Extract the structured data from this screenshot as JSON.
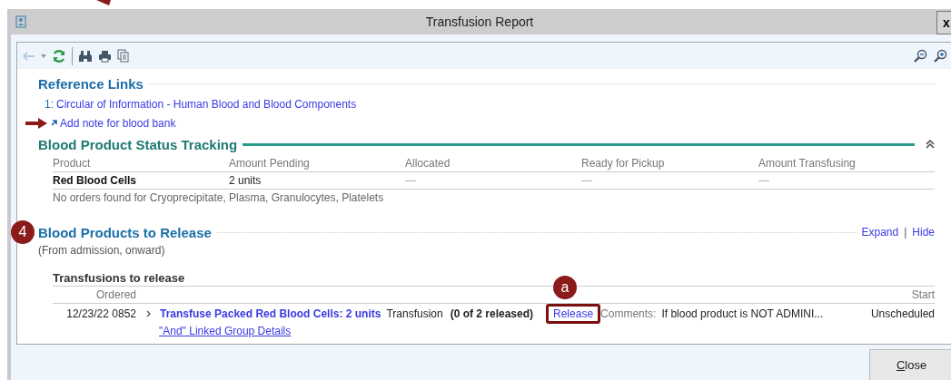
{
  "annotations": {
    "top_arrow": true
  },
  "window": {
    "title": "Transfusion Report",
    "close_glyph": "x"
  },
  "toolbar": {
    "back_disabled": true
  },
  "reference_links": {
    "heading": "Reference Links",
    "links": [
      {
        "number": "1:",
        "label": "Circular of Information - Human Blood and Blood Components"
      }
    ],
    "add_note": "Add note for blood bank",
    "add_note_marked": true
  },
  "status_tracking": {
    "heading": "Blood Product Status Tracking",
    "expanded": true,
    "columns": [
      "Product",
      "Amount Pending",
      "Allocated",
      "Ready for Pickup",
      "Amount Transfusing"
    ],
    "rows": [
      [
        "Red Blood Cells",
        "2 units",
        "—",
        "—",
        "—"
      ]
    ],
    "note": "No orders found for Cryoprecipitate, Plasma, Granulocytes, Platelets"
  },
  "release": {
    "step": "4",
    "heading": "Blood Products to Release",
    "subheading": "(From admission, onward)",
    "actions": [
      "Expand",
      "Hide"
    ],
    "separator": "|",
    "group_title": "Transfusions to release",
    "columns": {
      "ordered": "Ordered",
      "start": "Start"
    },
    "orders": [
      {
        "ordered": "12/23/22 0852",
        "name": "Transfuse Packed Red Blood Cells: 2 units",
        "type": "Transfusion",
        "released": "(0 of 2 released)",
        "action": "Release",
        "action_step": "a",
        "action_highlighted": true,
        "comments_label": "Comments:",
        "comments": "If blood product is NOT ADMINI...",
        "start": "Unscheduled",
        "linked": "\"And\" Linked Group Details"
      }
    ]
  },
  "footer": {
    "close": "Close"
  }
}
